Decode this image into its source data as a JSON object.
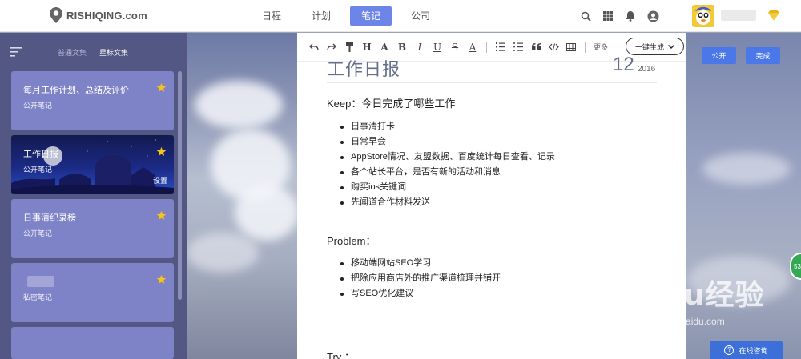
{
  "app": {
    "logo_text": "RISHIQING.com"
  },
  "nav": {
    "items": [
      "日程",
      "计划",
      "笔记",
      "公司"
    ],
    "active": "笔记"
  },
  "sidebar": {
    "tabs": [
      "普通文集",
      "星标文集"
    ],
    "active_tab": "星标文集",
    "cards": [
      {
        "title": "每月工作计划、总结及评价",
        "sub": "公开笔记",
        "starred": true
      },
      {
        "title": "工作日报",
        "sub": "公开笔记",
        "starred": true,
        "setting": "设置"
      },
      {
        "title": "日事清纪录榜",
        "sub": "公开笔记",
        "starred": true
      },
      {
        "title": "",
        "sub": "私密笔记",
        "starred": true
      }
    ]
  },
  "toolbar": {
    "more_label": "更多",
    "generate_label": "一键生成"
  },
  "document": {
    "title": "工作日报",
    "day": "12",
    "year": "2016",
    "sections": [
      {
        "title": "Keep：今日完成了哪些工作",
        "items": [
          "日事清打卡",
          "日常早会",
          " AppStore情况、友盟数据、百度统计每日查看、记录",
          "各个站长平台，是否有新的活动和消息",
          "购买ios关键词",
          "先闻道合作材料发送"
        ]
      },
      {
        "title": "Problem：",
        "items": [
          " 移动端网站SEO学习",
          "  把除应用商店外的推广渠道梳理并铺开",
          "  写SEO优化建议"
        ]
      },
      {
        "title": "Try ：",
        "items": []
      }
    ]
  },
  "actions": {
    "public_label": "公开",
    "done_label": "完成"
  },
  "side_badge": "53",
  "consult_label": "在线咨询",
  "watermark": {
    "brand": "Baidu经验",
    "sub": "jingyan.baidu.com"
  },
  "colors": {
    "accent": "#6d85e8",
    "sidebar": "#535783",
    "card": "#7e82c6",
    "blue": "#4b78e8",
    "star": "#f7c21d"
  }
}
